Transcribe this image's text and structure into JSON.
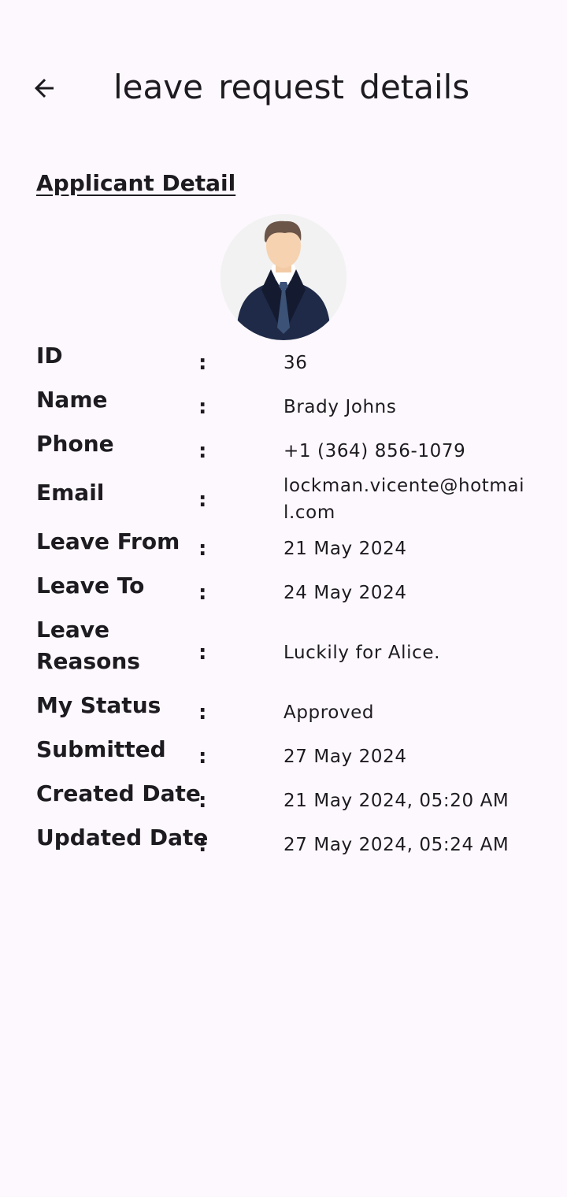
{
  "header": {
    "back_icon": "arrow-left-icon",
    "title": "leave request details"
  },
  "section": {
    "title": "Applicant Detail"
  },
  "avatar": {
    "icon": "person-avatar-icon"
  },
  "details": [
    {
      "label": "ID",
      "colon": ":",
      "value": "36"
    },
    {
      "label": "Name",
      "colon": ":",
      "value": "Brady Johns"
    },
    {
      "label": "Phone",
      "colon": ":",
      "value": "+1 (364) 856-1079"
    },
    {
      "label": "Email",
      "colon": ":",
      "value": "lockman.vicente@hotmail.com"
    },
    {
      "label": "Leave From",
      "colon": ":",
      "value": "21 May 2024"
    },
    {
      "label": "Leave To",
      "colon": ":",
      "value": "24 May 2024"
    },
    {
      "label": "Leave Reasons",
      "colon": ":",
      "value": "Luckily for Alice."
    },
    {
      "label": "My Status",
      "colon": ":",
      "value": "Approved"
    },
    {
      "label": "Submitted",
      "colon": ":",
      "value": "27 May 2024"
    },
    {
      "label": "Created Date",
      "colon": ":",
      "value": "21 May 2024, 05:20 AM"
    },
    {
      "label": "Updated Date",
      "colon": ":",
      "value": "27 May 2024, 05:24 AM"
    }
  ]
}
